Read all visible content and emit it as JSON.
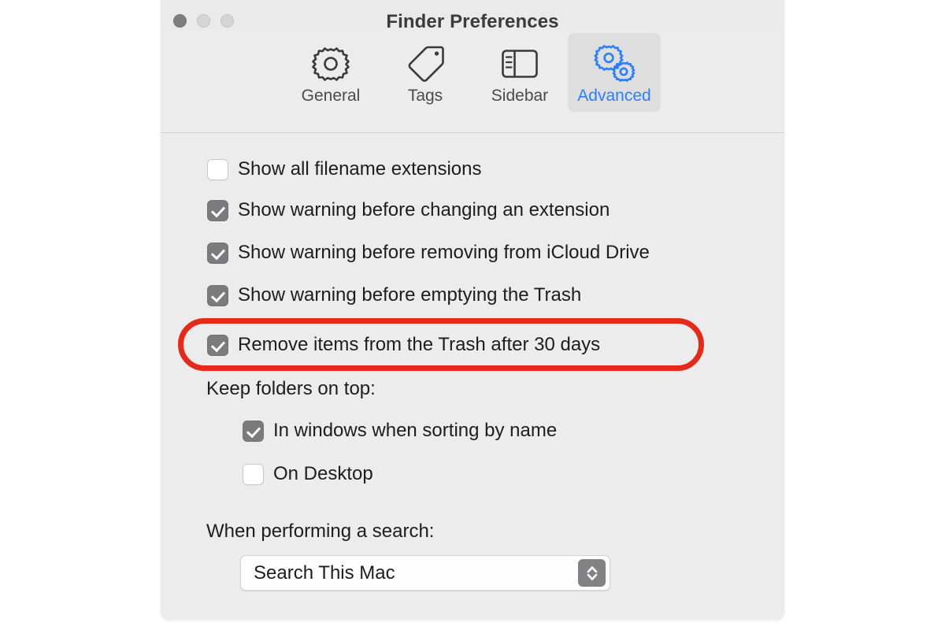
{
  "window": {
    "title": "Finder Preferences",
    "traffic_lights": [
      {
        "name": "close",
        "color": "#7e7e7e"
      },
      {
        "name": "minimize",
        "color": "#d5d5d5"
      },
      {
        "name": "maximize",
        "color": "#d5d5d5"
      }
    ]
  },
  "toolbar": {
    "tabs": [
      {
        "label": "General",
        "icon": "gear-icon",
        "selected": false
      },
      {
        "label": "Tags",
        "icon": "tag-icon",
        "selected": false
      },
      {
        "label": "Sidebar",
        "icon": "sidebar-icon",
        "selected": false
      },
      {
        "label": "Advanced",
        "icon": "two-gears-icon",
        "selected": true
      }
    ],
    "selected_tab": "Advanced",
    "selected_accent_color": "#2d7ff9"
  },
  "main": {
    "checkboxes": [
      {
        "label": "Show all filename extensions",
        "checked": false
      },
      {
        "label": "Show warning before changing an extension",
        "checked": true
      },
      {
        "label": "Show warning before removing from iCloud Drive",
        "checked": true
      },
      {
        "label": "Show warning before emptying the Trash",
        "checked": true
      },
      {
        "label": "Remove items from the Trash after 30 days",
        "checked": true
      }
    ],
    "keep_folders_label": "Keep folders on top:",
    "keep_folders_checkboxes": [
      {
        "label": "In windows when sorting by name",
        "checked": true
      },
      {
        "label": "On Desktop",
        "checked": false
      }
    ],
    "search_label": "When performing a search:",
    "search_value": "Search This Mac",
    "search_stepper_icon": "up-down-chevron-icon"
  },
  "annotation": {
    "name": "red-highlight-ellipse",
    "color": "#e42a1a",
    "targets": "Remove items from the Trash after 30 days"
  }
}
